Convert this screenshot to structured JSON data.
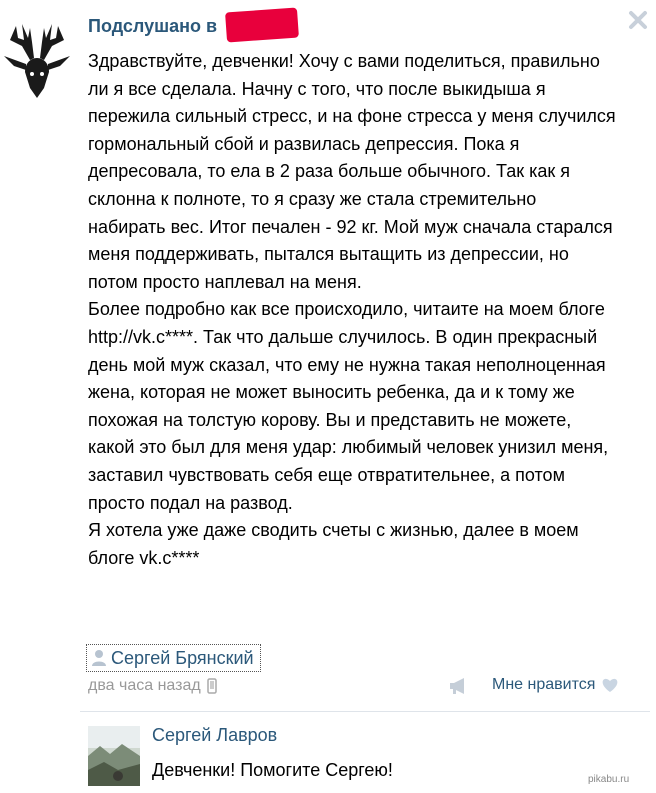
{
  "post": {
    "group_name": "Подслушано в",
    "paragraphs": [
      "Здравствуйте, девченки! Хочу с вами поделиться, правильно ли я все сделала. Начну с того, что после выкидыша я пережила сильный стресс, и на фоне стресса у меня случился гормональный сбой и развилась депрессия. Пока я депресовала, то ела в 2 раза больше обычного. Так как я склонна к полноте, то я сразу же стала стремительно набирать вес. Итог печален - 92 кг. Мой муж сначала старался меня поддерживать, пытался вытащить из депрессии, но потом просто наплевал на меня.",
      "Более подробно как все происходило, читаите на моем блоге http://vk.c****. Так что дальше случилось. В один прекрасный день мой муж сказал, что ему не нужна такая неполноценная жена, которая не может выносить ребенка, да и к тому же похожая на толстую корову. Вы и представить не можете, какой это был для меня удар: любимый человек унизил меня, заставил чувствовать себя еще отвратительнее, а потом просто подал на развод.",
      "Я хотела уже даже сводить счеты с жизнью, далее в моем блоге vk.c****"
    ],
    "signer": "Сергей Брянский",
    "time": "два часа назад",
    "like_label": "Мне нравится"
  },
  "comment": {
    "author": "Сергей Лавров",
    "text": "Девченки! Помогите Сергею!"
  },
  "watermark": "pikabu.ru",
  "colors": {
    "link": "#2b587a",
    "muted": "#999999",
    "redaction": "#e8003c"
  },
  "icons": [
    "deer-logo-icon",
    "close-icon",
    "user-icon",
    "mobile-icon",
    "megaphone-icon",
    "heart-icon"
  ]
}
